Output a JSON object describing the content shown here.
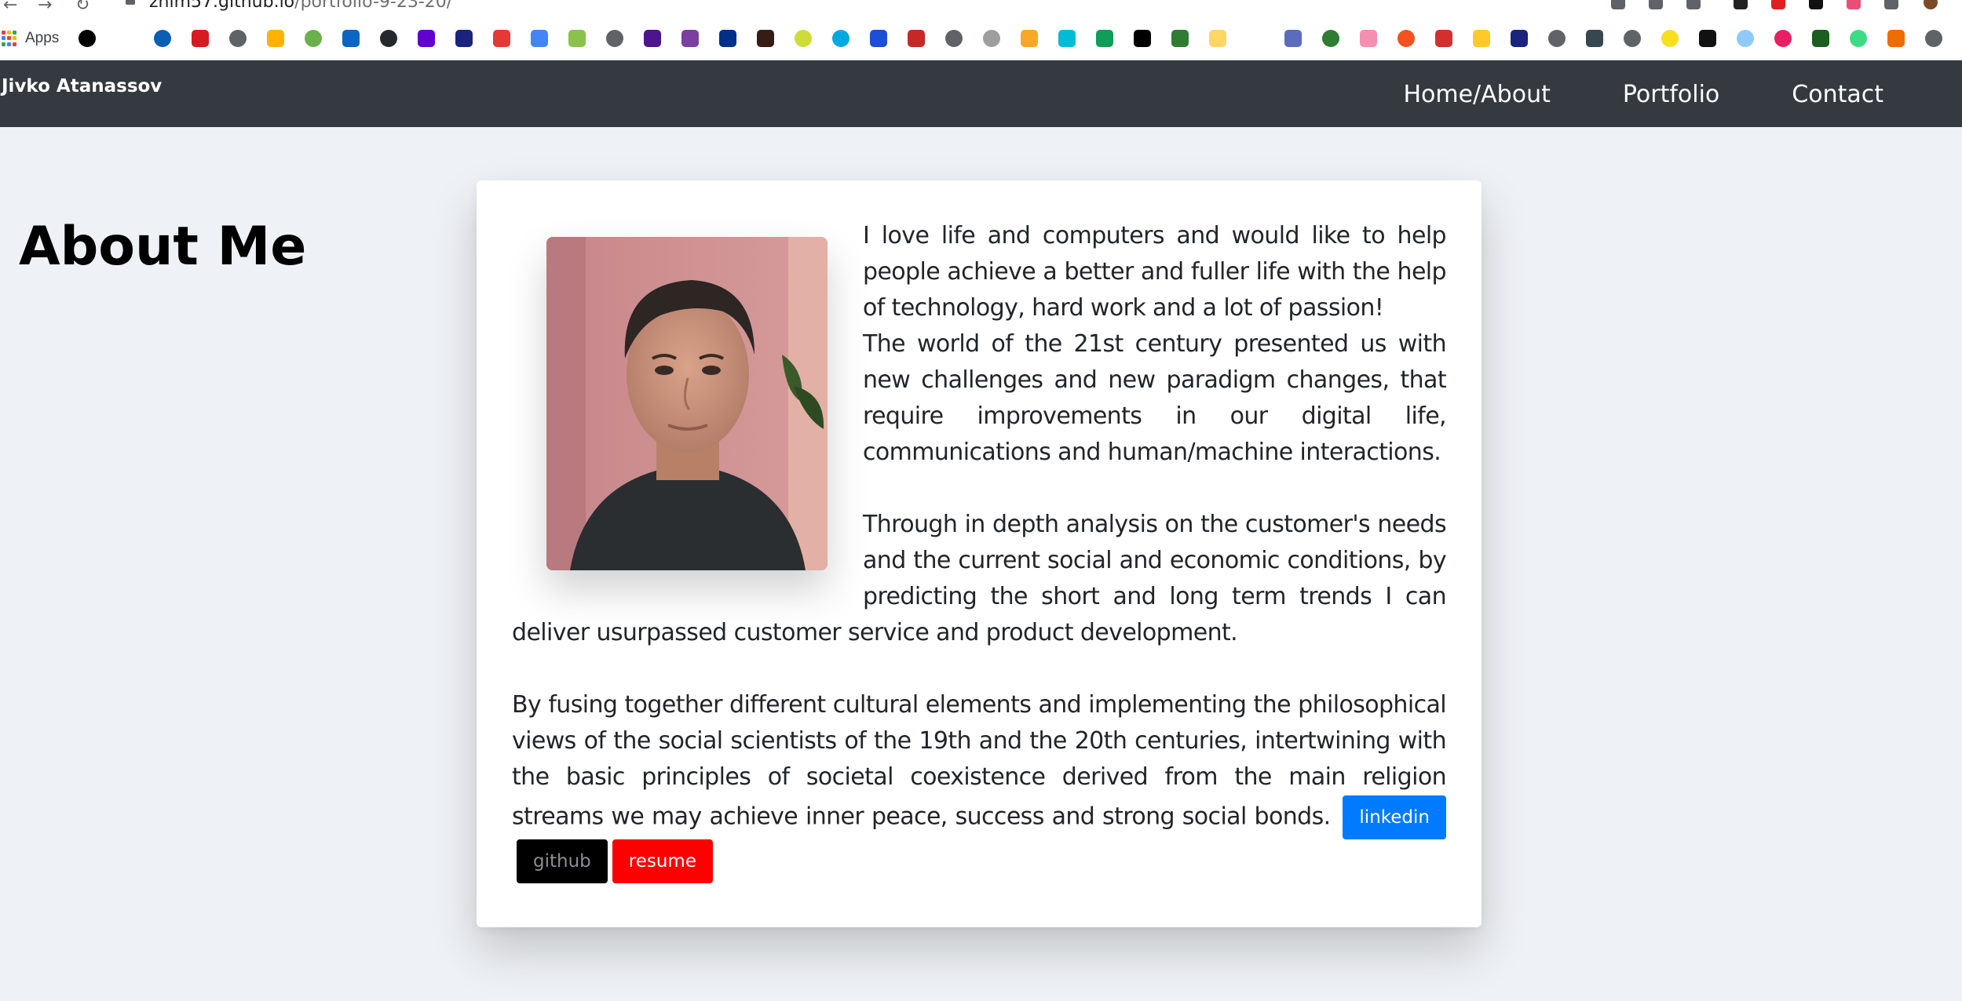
{
  "browser": {
    "url_host": "zhim57.github.io",
    "url_path": "/portfolio-9-23-20/",
    "apps_label": "Apps"
  },
  "site": {
    "brand": "Jivko Atanassov",
    "nav": [
      {
        "label": "Home/About"
      },
      {
        "label": "Portfolio"
      },
      {
        "label": "Contact"
      }
    ]
  },
  "about": {
    "title": "About Me",
    "p1": "I love life and computers and would like to help people achieve a better and fuller life with the help of technology, hard work and a lot of passion!",
    "p2": "The world of the 21st century presented us with new challenges and new paradigm changes, that require improvements in our digital life, communications and human/machine interactions.",
    "p3": "Through in depth analysis on the customer's needs and the current social and economic conditions, by predicting the short and long term trends I can deliver usurpassed customer service and product development.",
    "p4": "By fusing together different cultural elements and implementing the philosophical views of the social scientists of the 19th and the 20th centuries, intertwining with the basic principles of societal coexistence derived from the main religion streams we may achieve inner peace, success and strong social bonds.",
    "buttons": {
      "linkedin": "linkedin",
      "github": "github",
      "resume": "resume"
    }
  },
  "colors": {
    "navbar": "#343a40",
    "page_bg": "#eef1f5",
    "linkedin": "#007bff",
    "github": "#000000",
    "resume": "#ff0000"
  }
}
